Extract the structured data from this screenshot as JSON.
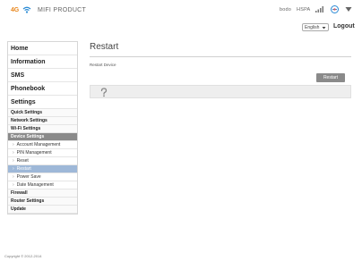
{
  "header": {
    "logo_text": "4G",
    "product_name": "MIFI PRODUCT",
    "network": "bodo",
    "network_type": "HSPA",
    "language": "English",
    "logout_label": "Logout"
  },
  "icons": {
    "wifi": "wifi-icon",
    "signal": "signal-icon",
    "roaming": "roam-icon",
    "user": "user-icon",
    "dropdown": "chevron-down-icon",
    "help": "help-icon"
  },
  "colors": {
    "brand": "#e8871e",
    "wifi": "#2a8ad4",
    "active_section": "#8a8a8a",
    "selected_item": "#9eb8d8"
  },
  "sidebar": {
    "main": [
      "Home",
      "Information",
      "SMS",
      "Phonebook",
      "Settings"
    ],
    "settings_subs": [
      "Quick Settings",
      "Network Settings",
      "Wi-Fi Settings",
      "Device Settings"
    ],
    "device_items": [
      "Account Management",
      "PIN Management",
      "Reset",
      "Restart",
      "Power Save",
      "Date Management"
    ],
    "more": [
      "Firewall",
      "Router Settings",
      "Update"
    ]
  },
  "main": {
    "title": "Restart",
    "description": "Restart Device",
    "restart_button": "Restart"
  },
  "footer": {
    "copyright": "Copyright © 2012-2014"
  }
}
